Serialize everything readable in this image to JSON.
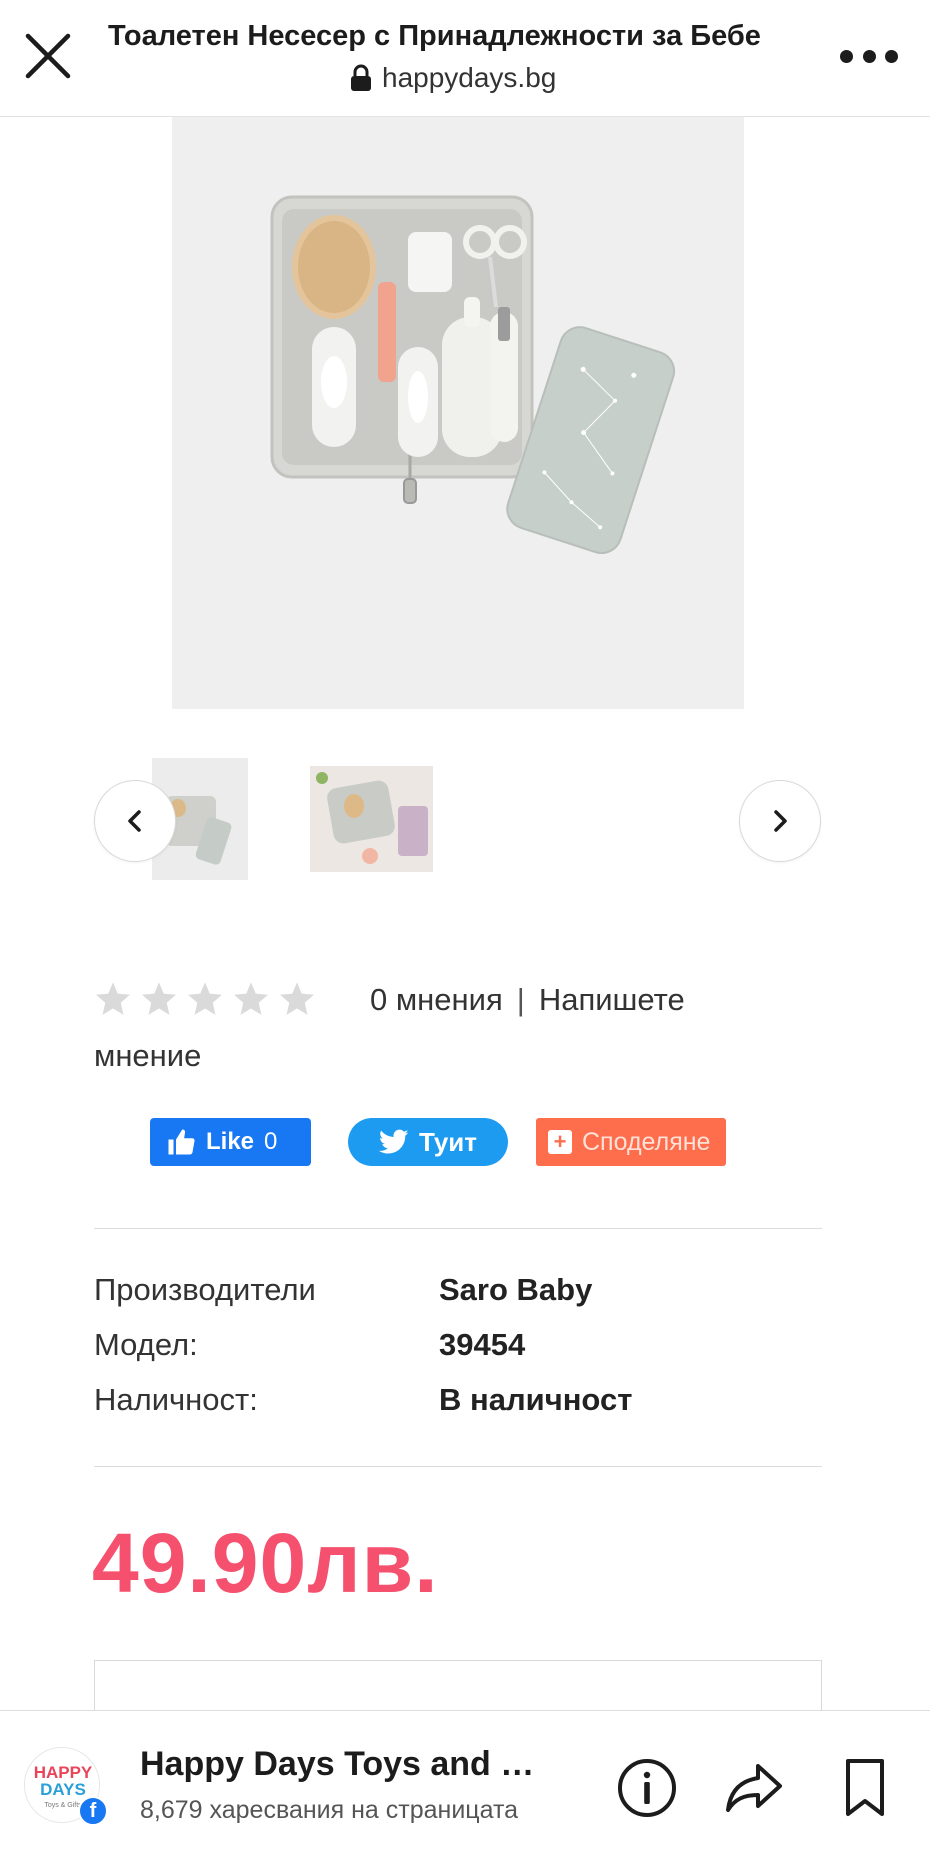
{
  "browser": {
    "title": "Тоалетен Несесер с Принадлежности за Бебе",
    "url": "happydays.bg",
    "icons": {
      "close": "close-icon",
      "lock": "lock-icon",
      "more": "more-icon"
    }
  },
  "product": {
    "rating": {
      "stars_filled": 0,
      "stars_total": 5,
      "reviews_count_label": "0 мнения",
      "separator": "|",
      "write_review_label_1": "Напишете",
      "write_review_label_2": "мнение"
    },
    "social": {
      "like_label": "Like",
      "like_count": "0",
      "tweet_label": "Туит",
      "share_label": "Споделяне"
    },
    "specs": [
      {
        "label": "Производители",
        "value": "Saro Baby"
      },
      {
        "label": "Модел:",
        "value": "39454"
      },
      {
        "label": "Наличност:",
        "value": "В наличност"
      }
    ],
    "price": "49.90лв."
  },
  "colors": {
    "price": "#f5506e",
    "facebook": "#1877f2",
    "twitter": "#1d9bf0",
    "share": "#fe6d4c"
  },
  "bottom_bar": {
    "page_name": "Happy Days Toys and Gifts",
    "page_likes": "8,679 харесвания на страницата",
    "logo_text_1": "HAPPY",
    "logo_text_2": "DAYS",
    "logo_text_3": "Toys & Gifts",
    "icons": {
      "info": "info-icon",
      "share": "share-icon",
      "bookmark": "bookmark-icon"
    }
  }
}
